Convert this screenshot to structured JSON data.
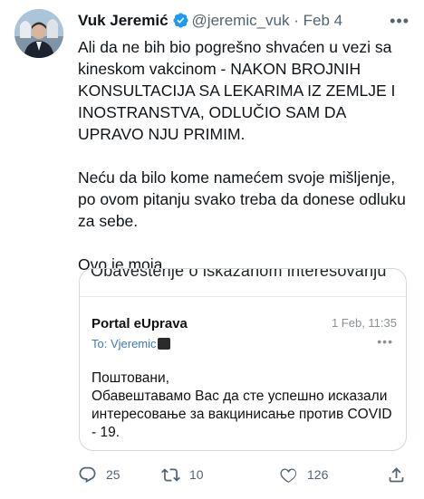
{
  "tweet": {
    "author_name": "Vuk Jeremić",
    "handle": "@jeremic_vuk",
    "separator": "·",
    "date": "Feb 4",
    "more_label": "•••",
    "text_paragraphs": [
      "Ali da ne bih bio pogrešno shvaćen u vezi sa kineskom vakcinom - NAKON BROJNIH KONSULTACIJA SA LEKARIMA IZ ZEMLJE I INOSTRANSTVA, ODLUČIO SAM DA UPRAVO NJU PRIMIM.",
      "Neću da bilo kome namećem svoje mišljenje, po ovom pitanju svako treba da donese odluku za sebe.",
      "Ovo je moja."
    ]
  },
  "email_card": {
    "subject": "Obaveštenje o iskazanom interesovanju",
    "sender": "Portal eUprava",
    "date": "1 Feb, 11:35",
    "to_label": "To: Vjeremic",
    "more_label": "•••",
    "body_lines": [
      "Поштовани,",
      "Обавештавамо Вас да сте успешно исказали интересовање за вакцинисање против COVID - 19."
    ]
  },
  "actions": {
    "replies": "25",
    "retweets": "10",
    "likes": "126"
  },
  "colors": {
    "verified": "#1d9bf0",
    "secondary_text": "#536471",
    "email_link": "#3a78c5"
  }
}
